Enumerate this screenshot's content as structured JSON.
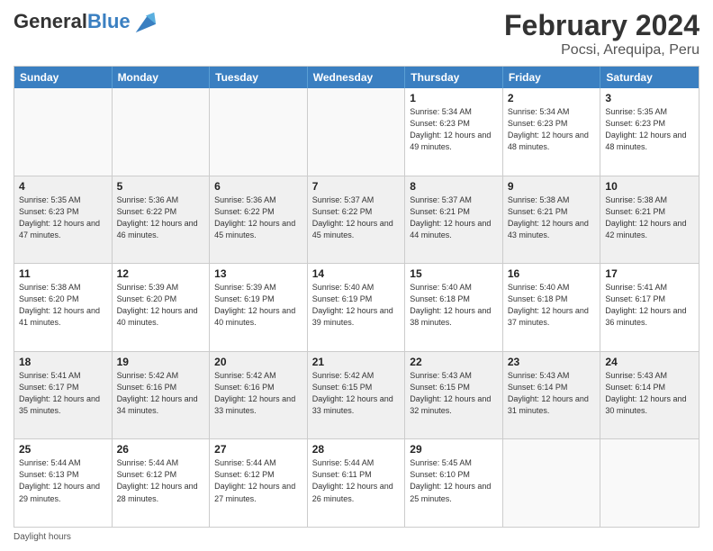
{
  "header": {
    "logo": {
      "general": "General",
      "blue": "Blue"
    },
    "title": "February 2024",
    "subtitle": "Pocsi, Arequipa, Peru"
  },
  "calendar": {
    "days_of_week": [
      "Sunday",
      "Monday",
      "Tuesday",
      "Wednesday",
      "Thursday",
      "Friday",
      "Saturday"
    ],
    "rows": [
      [
        {
          "day": "",
          "empty": true
        },
        {
          "day": "",
          "empty": true
        },
        {
          "day": "",
          "empty": true
        },
        {
          "day": "",
          "empty": true
        },
        {
          "day": "1",
          "sunrise": "5:34 AM",
          "sunset": "6:23 PM",
          "daylight": "12 hours and 49 minutes."
        },
        {
          "day": "2",
          "sunrise": "5:34 AM",
          "sunset": "6:23 PM",
          "daylight": "12 hours and 48 minutes."
        },
        {
          "day": "3",
          "sunrise": "5:35 AM",
          "sunset": "6:23 PM",
          "daylight": "12 hours and 48 minutes."
        }
      ],
      [
        {
          "day": "4",
          "sunrise": "5:35 AM",
          "sunset": "6:23 PM",
          "daylight": "12 hours and 47 minutes."
        },
        {
          "day": "5",
          "sunrise": "5:36 AM",
          "sunset": "6:22 PM",
          "daylight": "12 hours and 46 minutes."
        },
        {
          "day": "6",
          "sunrise": "5:36 AM",
          "sunset": "6:22 PM",
          "daylight": "12 hours and 45 minutes."
        },
        {
          "day": "7",
          "sunrise": "5:37 AM",
          "sunset": "6:22 PM",
          "daylight": "12 hours and 45 minutes."
        },
        {
          "day": "8",
          "sunrise": "5:37 AM",
          "sunset": "6:21 PM",
          "daylight": "12 hours and 44 minutes."
        },
        {
          "day": "9",
          "sunrise": "5:38 AM",
          "sunset": "6:21 PM",
          "daylight": "12 hours and 43 minutes."
        },
        {
          "day": "10",
          "sunrise": "5:38 AM",
          "sunset": "6:21 PM",
          "daylight": "12 hours and 42 minutes."
        }
      ],
      [
        {
          "day": "11",
          "sunrise": "5:38 AM",
          "sunset": "6:20 PM",
          "daylight": "12 hours and 41 minutes."
        },
        {
          "day": "12",
          "sunrise": "5:39 AM",
          "sunset": "6:20 PM",
          "daylight": "12 hours and 40 minutes."
        },
        {
          "day": "13",
          "sunrise": "5:39 AM",
          "sunset": "6:19 PM",
          "daylight": "12 hours and 40 minutes."
        },
        {
          "day": "14",
          "sunrise": "5:40 AM",
          "sunset": "6:19 PM",
          "daylight": "12 hours and 39 minutes."
        },
        {
          "day": "15",
          "sunrise": "5:40 AM",
          "sunset": "6:18 PM",
          "daylight": "12 hours and 38 minutes."
        },
        {
          "day": "16",
          "sunrise": "5:40 AM",
          "sunset": "6:18 PM",
          "daylight": "12 hours and 37 minutes."
        },
        {
          "day": "17",
          "sunrise": "5:41 AM",
          "sunset": "6:17 PM",
          "daylight": "12 hours and 36 minutes."
        }
      ],
      [
        {
          "day": "18",
          "sunrise": "5:41 AM",
          "sunset": "6:17 PM",
          "daylight": "12 hours and 35 minutes."
        },
        {
          "day": "19",
          "sunrise": "5:42 AM",
          "sunset": "6:16 PM",
          "daylight": "12 hours and 34 minutes."
        },
        {
          "day": "20",
          "sunrise": "5:42 AM",
          "sunset": "6:16 PM",
          "daylight": "12 hours and 33 minutes."
        },
        {
          "day": "21",
          "sunrise": "5:42 AM",
          "sunset": "6:15 PM",
          "daylight": "12 hours and 33 minutes."
        },
        {
          "day": "22",
          "sunrise": "5:43 AM",
          "sunset": "6:15 PM",
          "daylight": "12 hours and 32 minutes."
        },
        {
          "day": "23",
          "sunrise": "5:43 AM",
          "sunset": "6:14 PM",
          "daylight": "12 hours and 31 minutes."
        },
        {
          "day": "24",
          "sunrise": "5:43 AM",
          "sunset": "6:14 PM",
          "daylight": "12 hours and 30 minutes."
        }
      ],
      [
        {
          "day": "25",
          "sunrise": "5:44 AM",
          "sunset": "6:13 PM",
          "daylight": "12 hours and 29 minutes."
        },
        {
          "day": "26",
          "sunrise": "5:44 AM",
          "sunset": "6:12 PM",
          "daylight": "12 hours and 28 minutes."
        },
        {
          "day": "27",
          "sunrise": "5:44 AM",
          "sunset": "6:12 PM",
          "daylight": "12 hours and 27 minutes."
        },
        {
          "day": "28",
          "sunrise": "5:44 AM",
          "sunset": "6:11 PM",
          "daylight": "12 hours and 26 minutes."
        },
        {
          "day": "29",
          "sunrise": "5:45 AM",
          "sunset": "6:10 PM",
          "daylight": "12 hours and 25 minutes."
        },
        {
          "day": "",
          "empty": true
        },
        {
          "day": "",
          "empty": true
        }
      ]
    ]
  },
  "footer": {
    "daylight_label": "Daylight hours"
  }
}
